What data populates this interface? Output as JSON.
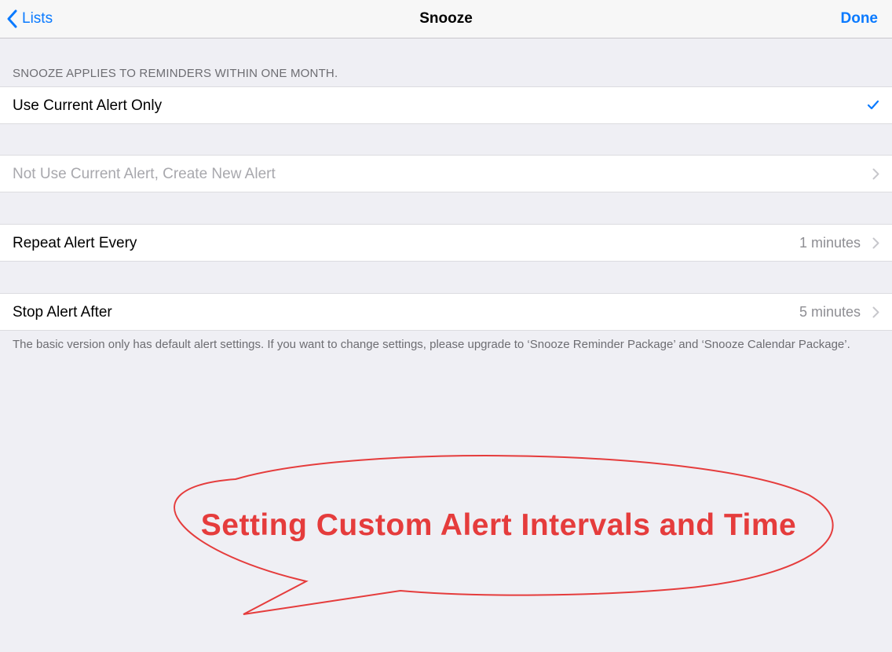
{
  "navbar": {
    "back_label": "Lists",
    "title": "Snooze",
    "done_label": "Done"
  },
  "section_header": "SNOOZE APPLIES TO REMINDERS WITHIN ONE MONTH.",
  "rows": [
    {
      "label": "Use Current Alert Only",
      "value": "",
      "accessory": "checkmark-icon",
      "selected": true
    },
    {
      "label": "Not Use Current Alert, Create New Alert",
      "value": "",
      "accessory": "chevron-right-icon",
      "disabled": true
    },
    {
      "label": "Repeat Alert Every",
      "value": "1 minutes",
      "accessory": "chevron-right-icon"
    },
    {
      "label": "Stop Alert After",
      "value": "5 minutes",
      "accessory": "chevron-right-icon"
    }
  ],
  "footer_note": "The basic version only has default alert settings. If you want to change settings, please upgrade to ‘Snooze Reminder Package’ and ‘Snooze Calendar Package’.",
  "annotation": {
    "text": "Setting Custom Alert Intervals and Time",
    "color": "#e53c3c"
  },
  "colors": {
    "accent": "#0a7aff",
    "background": "#efeff4",
    "secondary_text": "#8e8e93"
  }
}
